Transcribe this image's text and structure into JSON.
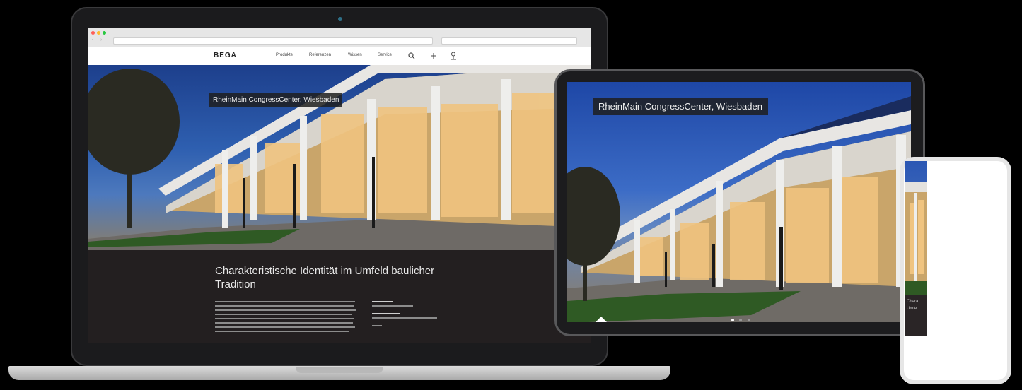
{
  "laptop": {
    "browser": {
      "title": "",
      "url": ""
    },
    "nav": {
      "logo": "BEGA",
      "items": [
        "Produkte",
        "Referenzen",
        "Wissen",
        "Service"
      ]
    },
    "breadcrumb": "",
    "hero_caption": "RheinMain CongressCenter, Wiesbaden",
    "headline": "Charakteristische Identität im Umfeld baulicher Tradition"
  },
  "tablet": {
    "hero_caption": "RheinMain CongressCenter, Wiesbaden"
  },
  "phone": {
    "text_lines": [
      "Chara",
      "Umfe"
    ]
  },
  "colors": {
    "background": "#000000",
    "sky": "#2e5fb0",
    "dark_band": "#231f20",
    "caption_bg": "#1e1e1e"
  }
}
